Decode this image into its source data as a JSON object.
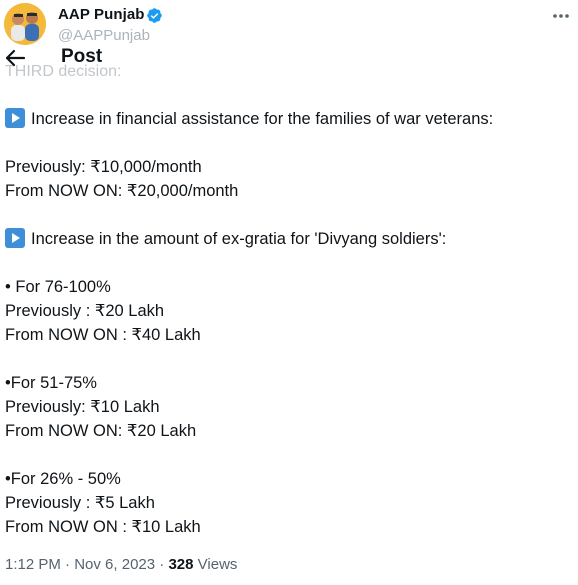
{
  "author": {
    "name": "AAP Punjab",
    "handle": "@AAPPunjab",
    "verified_icon": "verified-badge-icon",
    "more_icon": "more-dots-icon"
  },
  "header": {
    "back_icon": "back-arrow-icon",
    "title": "Post"
  },
  "ghost_line": "THIRD decision:",
  "body": {
    "heading1": "Increase in financial assistance for the families of war veterans:",
    "prev_month": "Previously: ₹10,000/month",
    "now_month": "From NOW ON: ₹20,000/month",
    "heading2": "Increase in the amount of ex-gratia for 'Divyang soldiers':",
    "tier1_label": "• For 76-100%",
    "tier1_prev": "Previously : ₹20 Lakh",
    "tier1_now": "From NOW ON : ₹40 Lakh",
    "tier2_label": "•For 51-75%",
    "tier2_prev": "Previously: ₹10 Lakh",
    "tier2_now": "From NOW ON: ₹20 Lakh",
    "tier3_label": "•For 26% - 50%",
    "tier3_prev": "Previously : ₹5 Lakh",
    "tier3_now": "From NOW ON : ₹10 Lakh"
  },
  "meta": {
    "time": "1:12 PM",
    "separator1": "·",
    "date": "Nov 6, 2023",
    "separator2": "·",
    "views_count": "328",
    "views_label": "Views"
  },
  "colors": {
    "text": "#0f1419",
    "secondary": "#536471",
    "verified": "#1d9bf0",
    "emoji_blue": "#3e8ed8"
  }
}
